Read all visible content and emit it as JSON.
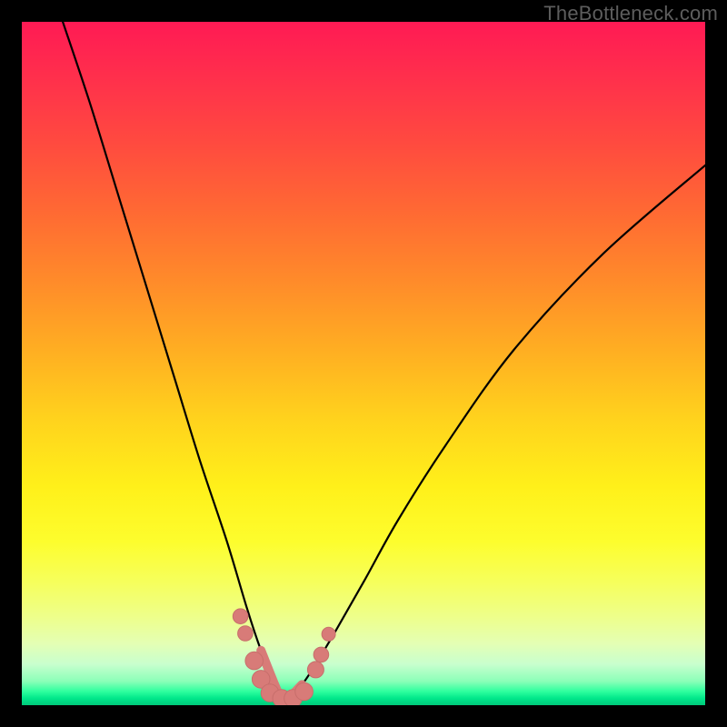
{
  "watermark": "TheBottleneck.com",
  "colors": {
    "frame": "#000000",
    "curve": "#000000",
    "marker_fill": "#d87b78",
    "marker_stroke": "#c76e6b"
  },
  "chart_data": {
    "type": "line",
    "title": "",
    "xlabel": "",
    "ylabel": "",
    "xlim": [
      0,
      100
    ],
    "ylim": [
      0,
      100
    ],
    "grid": false,
    "legend": false,
    "note": "Bottleneck curve. Vertical axis represents bottleneck percentage (0 at bottom = no bottleneck, 100 at top). Curve descends from top-left to a minimum near x≈38 then rises toward the right. No numeric tick labels are shown; values are pixel-estimated on a 0–100 scale.",
    "series": [
      {
        "name": "bottleneck-curve",
        "x": [
          6,
          10,
          14,
          18,
          22,
          26,
          30,
          33,
          35,
          37,
          38,
          39,
          41,
          43,
          46,
          50,
          55,
          62,
          72,
          85,
          100
        ],
        "y": [
          100,
          88,
          75,
          62,
          49,
          36,
          24,
          14,
          8,
          3,
          1,
          1,
          3,
          6,
          11,
          18,
          27,
          38,
          52,
          66,
          79
        ]
      }
    ],
    "markers": {
      "name": "highlight-dots",
      "note": "Pink circular markers clustered near the curve minimum.",
      "points": [
        {
          "x": 32.0,
          "y": 13.0,
          "r": 1.1
        },
        {
          "x": 32.7,
          "y": 10.5,
          "r": 1.1
        },
        {
          "x": 34.0,
          "y": 6.5,
          "r": 1.3
        },
        {
          "x": 35.0,
          "y": 3.8,
          "r": 1.3
        },
        {
          "x": 36.3,
          "y": 1.8,
          "r": 1.3
        },
        {
          "x": 38.0,
          "y": 1.0,
          "r": 1.3
        },
        {
          "x": 39.7,
          "y": 1.0,
          "r": 1.3
        },
        {
          "x": 41.3,
          "y": 2.0,
          "r": 1.3
        },
        {
          "x": 43.0,
          "y": 5.2,
          "r": 1.2
        },
        {
          "x": 43.8,
          "y": 7.4,
          "r": 1.1
        },
        {
          "x": 44.9,
          "y": 10.4,
          "r": 1.0
        }
      ]
    }
  }
}
